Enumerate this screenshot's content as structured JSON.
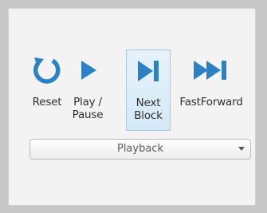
{
  "ribbon": {
    "buttons": [
      {
        "label": "Reset",
        "icon": "reset-icon"
      },
      {
        "label": "Play /\nPause",
        "icon": "play-icon"
      },
      {
        "label": "Next\nBlock",
        "icon": "next-block-icon"
      },
      {
        "label": "FastForward",
        "icon": "fast-forward-icon"
      }
    ],
    "group_label": "Playback"
  },
  "colors": {
    "icon_blue": "#2a82c5",
    "active_bg": "#d7ebf9",
    "active_border": "#a6c8e6"
  }
}
